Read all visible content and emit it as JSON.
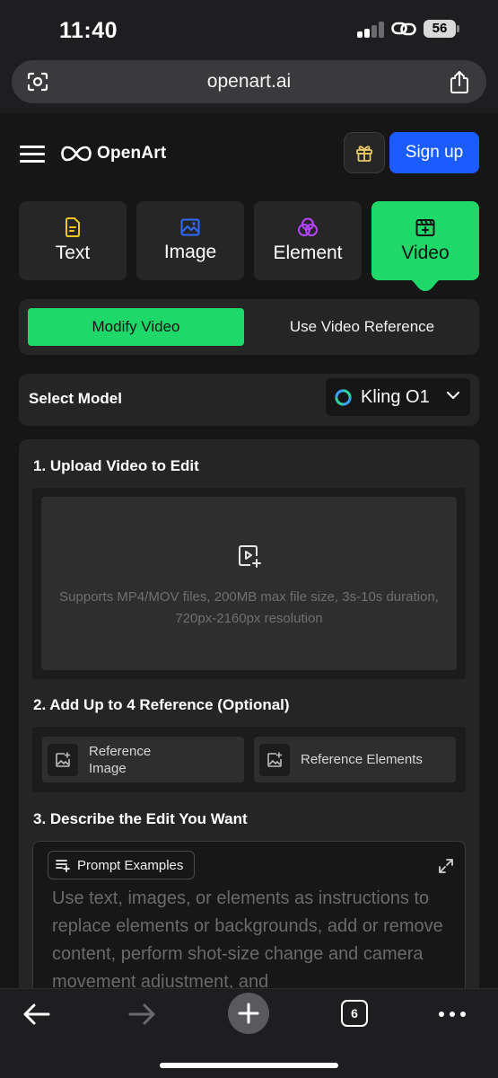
{
  "status_bar": {
    "time": "11:40",
    "battery": "56"
  },
  "browser": {
    "url": "openart.ai",
    "tabs_count": "6"
  },
  "header": {
    "brand": "OpenArt",
    "signup_label": "Sign up"
  },
  "tabs": [
    {
      "label": "Text",
      "icon": "document-icon",
      "color": "#f5c518"
    },
    {
      "label": "Image",
      "icon": "image-icon",
      "color": "#2f6bff"
    },
    {
      "label": "Element",
      "icon": "circles-icon",
      "color": "#b445ff"
    },
    {
      "label": "Video",
      "icon": "video-clapper-icon",
      "color": "#111111",
      "active": true
    }
  ],
  "mode": {
    "active": "Modify Video",
    "inactive": "Use Video Reference"
  },
  "model": {
    "label": "Select Model",
    "value": "Kling O1"
  },
  "upload": {
    "title": "1. Upload Video to Edit",
    "description": "Supports MP4/MOV files, 200MB max file size, 3s-10s duration, 720px-2160px resolution"
  },
  "references": {
    "title": "2. Add Up to 4 Reference (Optional)",
    "image_line1": "Reference",
    "image_line2": "Image",
    "elements_label": "Reference Elements"
  },
  "describe": {
    "title": "3. Describe the Edit You Want",
    "examples_label": "Prompt Examples",
    "placeholder": "Use text, images, or elements as instructions to replace elements or backgrounds, add or remove content, perform shot-size change and camera movement adjustment, and"
  },
  "colors": {
    "accent_green": "#1fd86a",
    "signup_blue": "#1a5cff"
  }
}
